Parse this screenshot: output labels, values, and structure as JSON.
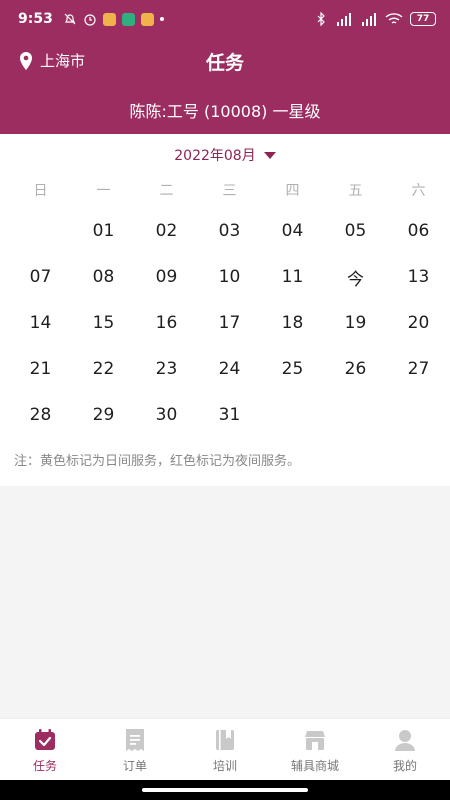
{
  "status_bar": {
    "time": "9:53",
    "battery": "77",
    "icons": [
      "mute-bell-icon",
      "alarm-icon",
      "app-icon",
      "shield-app-icon",
      "app-icon",
      "dot-icon",
      "bluetooth-icon",
      "signal-hd-icon",
      "signal-hd-icon",
      "wifi-icon",
      "battery-icon"
    ]
  },
  "header": {
    "location": "上海市",
    "title": "任务"
  },
  "subheader": {
    "text": "陈陈:工号 (10008) 一星级"
  },
  "calendar": {
    "month_label": "2022年08月",
    "weekdays": [
      "日",
      "一",
      "二",
      "三",
      "四",
      "五",
      "六"
    ],
    "days": [
      "",
      "01",
      "02",
      "03",
      "04",
      "05",
      "06",
      "07",
      "08",
      "09",
      "10",
      "11",
      "今",
      "13",
      "14",
      "15",
      "16",
      "17",
      "18",
      "19",
      "20",
      "21",
      "22",
      "23",
      "24",
      "25",
      "26",
      "27",
      "28",
      "29",
      "30",
      "31",
      "",
      "",
      ""
    ],
    "note": "注：黄色标记为日间服务，红色标记为夜间服务。"
  },
  "tabbar": {
    "items": [
      {
        "label": "任务",
        "active": true
      },
      {
        "label": "订单",
        "active": false
      },
      {
        "label": "培训",
        "active": false
      },
      {
        "label": "辅具商城",
        "active": false
      },
      {
        "label": "我的",
        "active": false
      }
    ]
  },
  "colors": {
    "brand": "#9c2d60",
    "inactive_icon": "#c9c9c9"
  }
}
